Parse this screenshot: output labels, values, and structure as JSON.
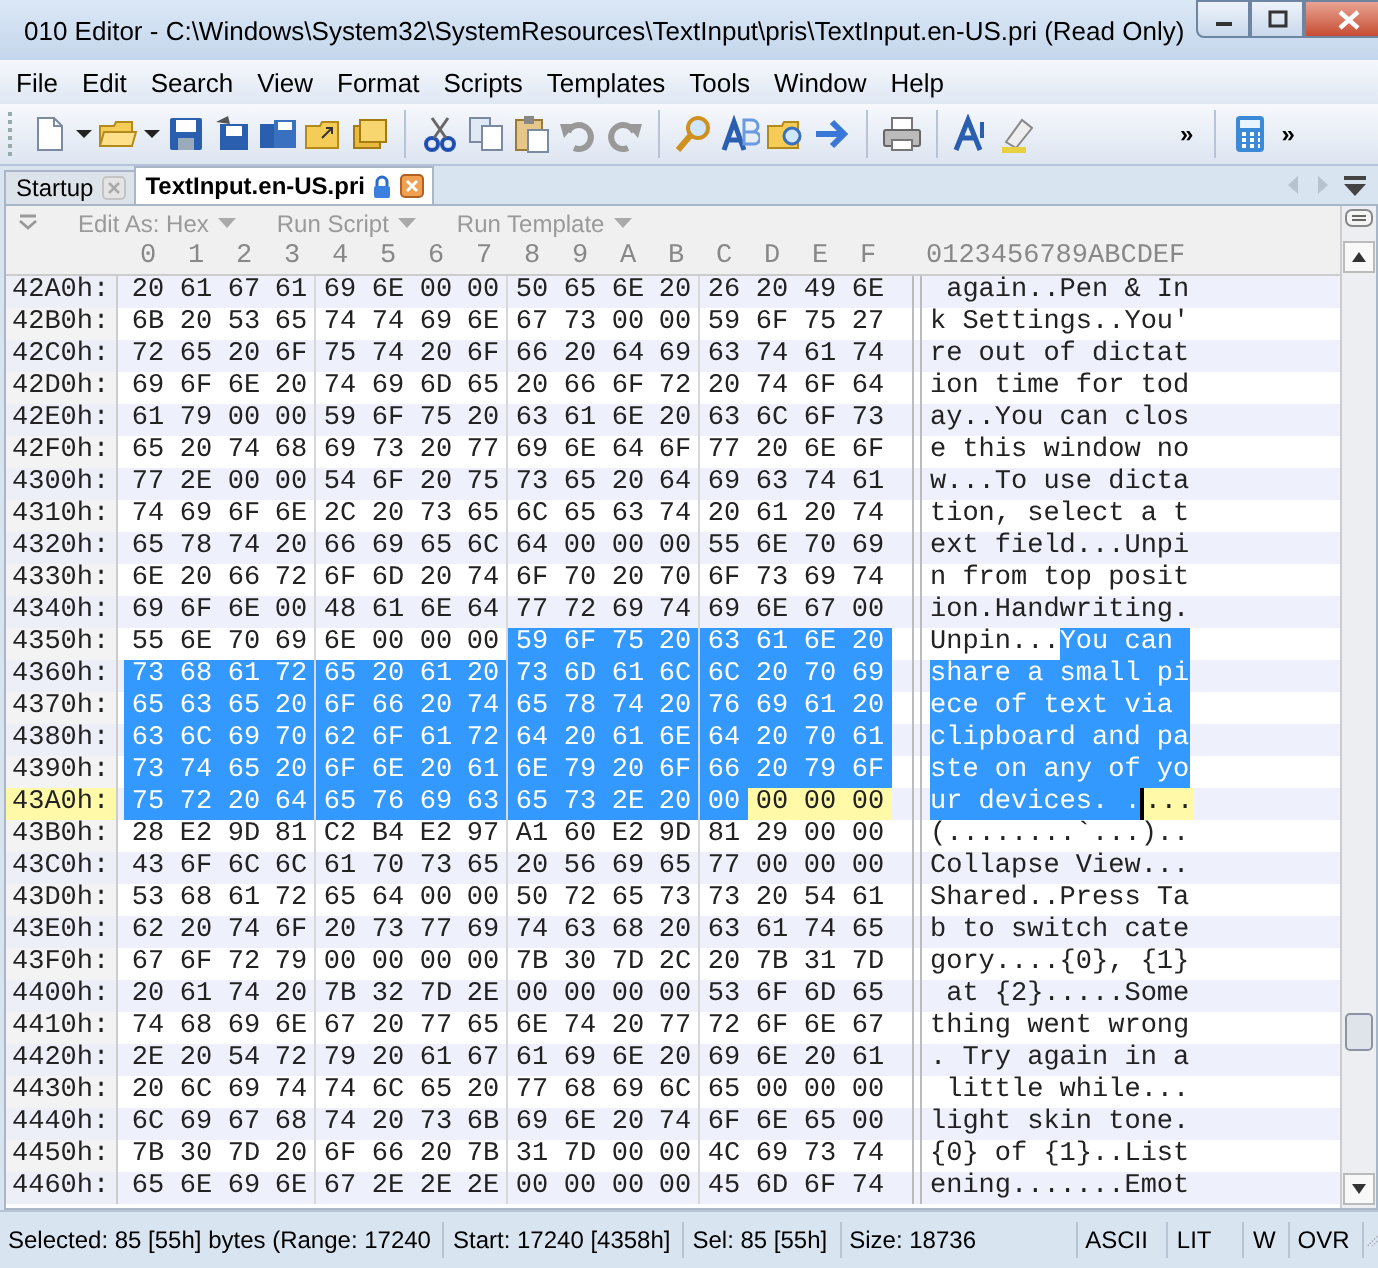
{
  "window": {
    "title": "010 Editor - C:\\Windows\\System32\\SystemResources\\TextInput\\pris\\TextInput.en-US.pri (Read Only)"
  },
  "menu": [
    "File",
    "Edit",
    "Search",
    "View",
    "Format",
    "Scripts",
    "Templates",
    "Tools",
    "Window",
    "Help"
  ],
  "toolbar": {
    "overflow": [
      "»",
      "»"
    ]
  },
  "tabs": [
    {
      "label": "Startup",
      "selected": false,
      "locked": false
    },
    {
      "label": "TextInput.en-US.pri",
      "selected": true,
      "locked": true
    }
  ],
  "script_bar": [
    {
      "label": "Edit As: Hex",
      "disabled": true
    },
    {
      "label": "Run Script",
      "disabled": true
    },
    {
      "label": "Run Template",
      "disabled": true
    }
  ],
  "hex_view": {
    "columns": [
      "0",
      "1",
      "2",
      "3",
      "4",
      "5",
      "6",
      "7",
      "8",
      "9",
      "A",
      "B",
      "C",
      "D",
      "E",
      "F"
    ],
    "ascii_header": "0123456789ABCDEF",
    "rows": [
      {
        "offset": "42A0h:",
        "current": false,
        "hex": [
          {
            "bytes": "20 61 67 61 69 6E 00 00 50 65 6E 20 26 20 49 6E",
            "selected": false
          }
        ],
        "ascii": [
          {
            "text": " again..Pen & In",
            "selected": false
          }
        ]
      },
      {
        "offset": "42B0h:",
        "current": false,
        "hex": [
          {
            "bytes": "6B 20 53 65 74 74 69 6E 67 73 00 00 59 6F 75 27",
            "selected": false
          }
        ],
        "ascii": [
          {
            "text": "k Settings..You'",
            "selected": false
          }
        ]
      },
      {
        "offset": "42C0h:",
        "current": false,
        "hex": [
          {
            "bytes": "72 65 20 6F 75 74 20 6F 66 20 64 69 63 74 61 74",
            "selected": false
          }
        ],
        "ascii": [
          {
            "text": "re out of dictat",
            "selected": false
          }
        ]
      },
      {
        "offset": "42D0h:",
        "current": false,
        "hex": [
          {
            "bytes": "69 6F 6E 20 74 69 6D 65 20 66 6F 72 20 74 6F 64",
            "selected": false
          }
        ],
        "ascii": [
          {
            "text": "ion time for tod",
            "selected": false
          }
        ]
      },
      {
        "offset": "42E0h:",
        "current": false,
        "hex": [
          {
            "bytes": "61 79 00 00 59 6F 75 20 63 61 6E 20 63 6C 6F 73",
            "selected": false
          }
        ],
        "ascii": [
          {
            "text": "ay..You can clos",
            "selected": false
          }
        ]
      },
      {
        "offset": "42F0h:",
        "current": false,
        "hex": [
          {
            "bytes": "65 20 74 68 69 73 20 77 69 6E 64 6F 77 20 6E 6F",
            "selected": false
          }
        ],
        "ascii": [
          {
            "text": "e this window no",
            "selected": false
          }
        ]
      },
      {
        "offset": "4300h:",
        "current": false,
        "hex": [
          {
            "bytes": "77 2E 00 00 54 6F 20 75 73 65 20 64 69 63 74 61",
            "selected": false
          }
        ],
        "ascii": [
          {
            "text": "w...To use dicta",
            "selected": false
          }
        ]
      },
      {
        "offset": "4310h:",
        "current": false,
        "hex": [
          {
            "bytes": "74 69 6F 6E 2C 20 73 65 6C 65 63 74 20 61 20 74",
            "selected": false
          }
        ],
        "ascii": [
          {
            "text": "tion, select a t",
            "selected": false
          }
        ]
      },
      {
        "offset": "4320h:",
        "current": false,
        "hex": [
          {
            "bytes": "65 78 74 20 66 69 65 6C 64 00 00 00 55 6E 70 69",
            "selected": false
          }
        ],
        "ascii": [
          {
            "text": "ext field...Unpi",
            "selected": false
          }
        ]
      },
      {
        "offset": "4330h:",
        "current": false,
        "hex": [
          {
            "bytes": "6E 20 66 72 6F 6D 20 74 6F 70 20 70 6F 73 69 74",
            "selected": false
          }
        ],
        "ascii": [
          {
            "text": "n from top posit",
            "selected": false
          }
        ]
      },
      {
        "offset": "4340h:",
        "current": false,
        "hex": [
          {
            "bytes": "69 6F 6E 00 48 61 6E 64 77 72 69 74 69 6E 67 00",
            "selected": false
          }
        ],
        "ascii": [
          {
            "text": "ion.Handwriting.",
            "selected": false
          }
        ]
      },
      {
        "offset": "4350h:",
        "current": false,
        "hex": [
          {
            "bytes": "55 6E 70 69 6E 00 00 00",
            "selected": false
          },
          {
            "bytes": "59 6F 75 20 63 61 6E 20",
            "selected": true
          }
        ],
        "ascii": [
          {
            "text": "Unpin...",
            "selected": false
          },
          {
            "text": "You can ",
            "selected": true
          }
        ]
      },
      {
        "offset": "4360h:",
        "current": false,
        "hex": [
          {
            "bytes": "73 68 61 72 65 20 61 20 73 6D 61 6C 6C 20 70 69",
            "selected": true
          }
        ],
        "ascii": [
          {
            "text": "share a small pi",
            "selected": true
          }
        ]
      },
      {
        "offset": "4370h:",
        "current": false,
        "hex": [
          {
            "bytes": "65 63 65 20 6F 66 20 74 65 78 74 20 76 69 61 20",
            "selected": true
          }
        ],
        "ascii": [
          {
            "text": "ece of text via ",
            "selected": true
          }
        ]
      },
      {
        "offset": "4380h:",
        "current": false,
        "hex": [
          {
            "bytes": "63 6C 69 70 62 6F 61 72 64 20 61 6E 64 20 70 61",
            "selected": true
          }
        ],
        "ascii": [
          {
            "text": "clipboard and pa",
            "selected": true
          }
        ]
      },
      {
        "offset": "4390h:",
        "current": false,
        "hex": [
          {
            "bytes": "73 74 65 20 6F 6E 20 61 6E 79 20 6F 66 20 79 6F",
            "selected": true
          }
        ],
        "ascii": [
          {
            "text": "ste on any of yo",
            "selected": true
          }
        ]
      },
      {
        "offset": "43A0h:",
        "current": true,
        "hex": [
          {
            "bytes": "75 72 20 64 65 76 69 63 65 73 2E 20 00",
            "selected": true
          },
          {
            "bytes": "00 00 00",
            "selected": false
          }
        ],
        "ascii": [
          {
            "text": "ur devices. .",
            "selected": true
          },
          {
            "text": "...",
            "selected": false
          }
        ]
      },
      {
        "offset": "43B0h:",
        "current": false,
        "hex": [
          {
            "bytes": "28 E2 9D 81 C2 B4 E2 97 A1 60 E2 9D 81 29 00 00",
            "selected": false
          }
        ],
        "ascii": [
          {
            "text": "(........`...)..",
            "selected": false
          }
        ]
      },
      {
        "offset": "43C0h:",
        "current": false,
        "hex": [
          {
            "bytes": "43 6F 6C 6C 61 70 73 65 20 56 69 65 77 00 00 00",
            "selected": false
          }
        ],
        "ascii": [
          {
            "text": "Collapse View...",
            "selected": false
          }
        ]
      },
      {
        "offset": "43D0h:",
        "current": false,
        "hex": [
          {
            "bytes": "53 68 61 72 65 64 00 00 50 72 65 73 73 20 54 61",
            "selected": false
          }
        ],
        "ascii": [
          {
            "text": "Shared..Press Ta",
            "selected": false
          }
        ]
      },
      {
        "offset": "43E0h:",
        "current": false,
        "hex": [
          {
            "bytes": "62 20 74 6F 20 73 77 69 74 63 68 20 63 61 74 65",
            "selected": false
          }
        ],
        "ascii": [
          {
            "text": "b to switch cate",
            "selected": false
          }
        ]
      },
      {
        "offset": "43F0h:",
        "current": false,
        "hex": [
          {
            "bytes": "67 6F 72 79 00 00 00 00 7B 30 7D 2C 20 7B 31 7D",
            "selected": false
          }
        ],
        "ascii": [
          {
            "text": "gory....{0}, {1}",
            "selected": false
          }
        ]
      },
      {
        "offset": "4400h:",
        "current": false,
        "hex": [
          {
            "bytes": "20 61 74 20 7B 32 7D 2E 00 00 00 00 53 6F 6D 65",
            "selected": false
          }
        ],
        "ascii": [
          {
            "text": " at {2}.....Some",
            "selected": false
          }
        ]
      },
      {
        "offset": "4410h:",
        "current": false,
        "hex": [
          {
            "bytes": "74 68 69 6E 67 20 77 65 6E 74 20 77 72 6F 6E 67",
            "selected": false
          }
        ],
        "ascii": [
          {
            "text": "thing went wrong",
            "selected": false
          }
        ]
      },
      {
        "offset": "4420h:",
        "current": false,
        "hex": [
          {
            "bytes": "2E 20 54 72 79 20 61 67 61 69 6E 20 69 6E 20 61",
            "selected": false
          }
        ],
        "ascii": [
          {
            "text": ". Try again in a",
            "selected": false
          }
        ]
      },
      {
        "offset": "4430h:",
        "current": false,
        "hex": [
          {
            "bytes": "20 6C 69 74 74 6C 65 20 77 68 69 6C 65 00 00 00",
            "selected": false
          }
        ],
        "ascii": [
          {
            "text": " little while...",
            "selected": false
          }
        ]
      },
      {
        "offset": "4440h:",
        "current": false,
        "hex": [
          {
            "bytes": "6C 69 67 68 74 20 73 6B 69 6E 20 74 6F 6E 65 00",
            "selected": false
          }
        ],
        "ascii": [
          {
            "text": "light skin tone.",
            "selected": false
          }
        ]
      },
      {
        "offset": "4450h:",
        "current": false,
        "hex": [
          {
            "bytes": "7B 30 7D 20 6F 66 20 7B 31 7D 00 00 4C 69 73 74",
            "selected": false
          }
        ],
        "ascii": [
          {
            "text": "{0} of {1}..List",
            "selected": false
          }
        ]
      },
      {
        "offset": "4460h:",
        "current": false,
        "hex": [
          {
            "bytes": "65 6E 69 6E 67 2E 2E 2E 00 00 00 00 45 6D 6F 74",
            "selected": false
          }
        ],
        "ascii": [
          {
            "text": "ening.......Emot",
            "selected": false
          }
        ]
      }
    ]
  },
  "status_bar": [
    "Selected: 85 [55h] bytes (Range: 17240",
    "Start: 17240 [4358h]",
    "Sel: 85 [55h]",
    "Size: 18736",
    "ASCII",
    "LIT",
    "W",
    "OVR"
  ]
}
